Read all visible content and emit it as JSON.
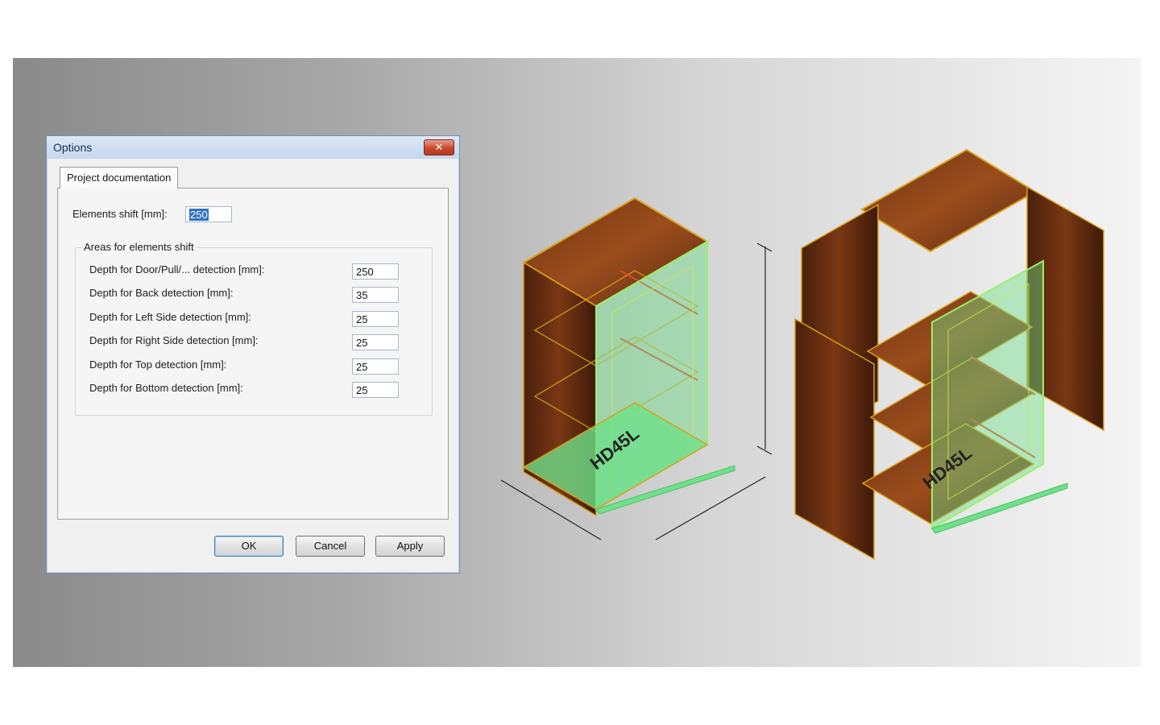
{
  "dialog": {
    "title": "Options",
    "close_glyph": "✕",
    "tab_label": "Project documentation",
    "elements_shift": {
      "label": "Elements shift [mm]:",
      "value": "250"
    },
    "group_title": "Areas for elements shift",
    "fields": [
      {
        "label": "Depth for Door/Pull/... detection [mm]:",
        "value": "250"
      },
      {
        "label": "Depth for Back detection [mm]:",
        "value": "35"
      },
      {
        "label": "Depth for Left Side detection [mm]:",
        "value": "25"
      },
      {
        "label": "Depth for Right Side detection [mm]:",
        "value": "25"
      },
      {
        "label": "Depth for Top detection [mm]:",
        "value": "25"
      },
      {
        "label": "Depth for Bottom detection [mm]:",
        "value": "25"
      }
    ],
    "buttons": {
      "ok": "OK",
      "cancel": "Cancel",
      "apply": "Apply"
    }
  },
  "renders": {
    "cabinet_label": "HD45L",
    "exploded_label": "HD45L"
  },
  "colors": {
    "wood_dark": "#5a2a10",
    "wood_mid": "#8a4418",
    "edge": "#d9a11a",
    "door_green": "#6fe08a",
    "dimension_line": "#222222"
  }
}
